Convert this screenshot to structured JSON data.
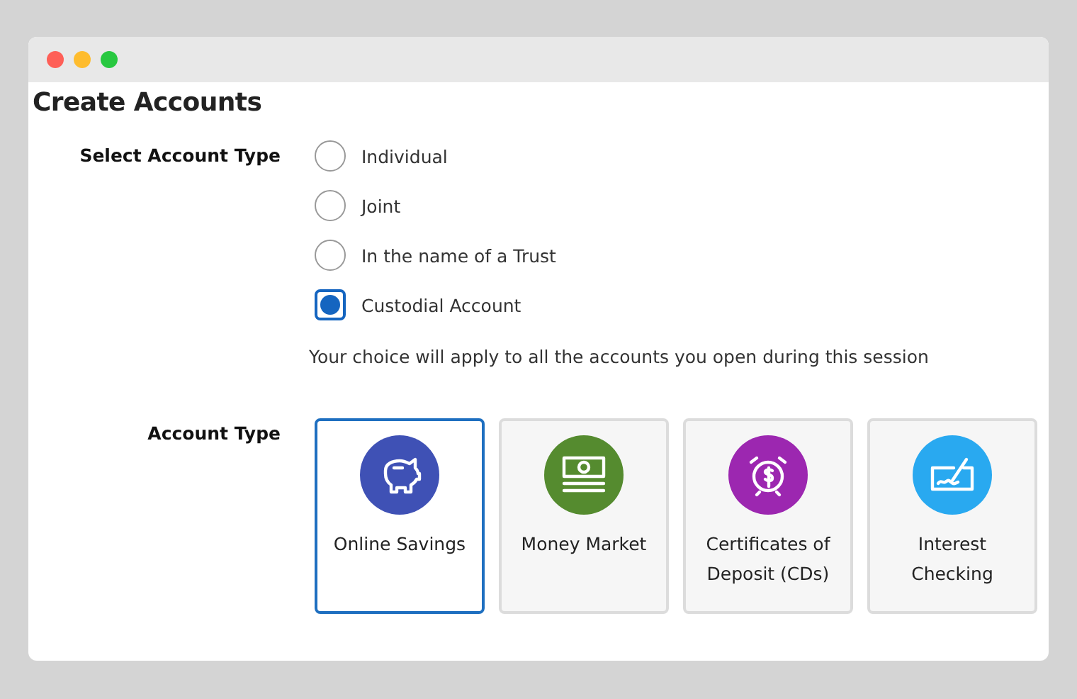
{
  "window": {
    "title": "Create Accounts"
  },
  "select_account_type": {
    "label": "Select Account Type",
    "options": [
      {
        "label": "Individual",
        "selected": false
      },
      {
        "label": "Joint",
        "selected": false
      },
      {
        "label": "In the name of a Trust",
        "selected": false
      },
      {
        "label": "Custodial Account",
        "selected": true
      }
    ],
    "note": "Your choice will apply to all the accounts you open during this session"
  },
  "account_type": {
    "label": "Account Type",
    "cards": [
      {
        "kind": "piggy",
        "label": "Online Savings",
        "color": "#3f51b5",
        "selected": true
      },
      {
        "kind": "cash",
        "label": "Money Market",
        "color": "#558b2f",
        "selected": false
      },
      {
        "kind": "clock",
        "label": "Certificates of Deposit (CDs)",
        "color": "#9c27b0",
        "selected": false
      },
      {
        "kind": "check",
        "label": "Interest Checking",
        "color": "#29a9f0",
        "selected": false
      }
    ]
  }
}
